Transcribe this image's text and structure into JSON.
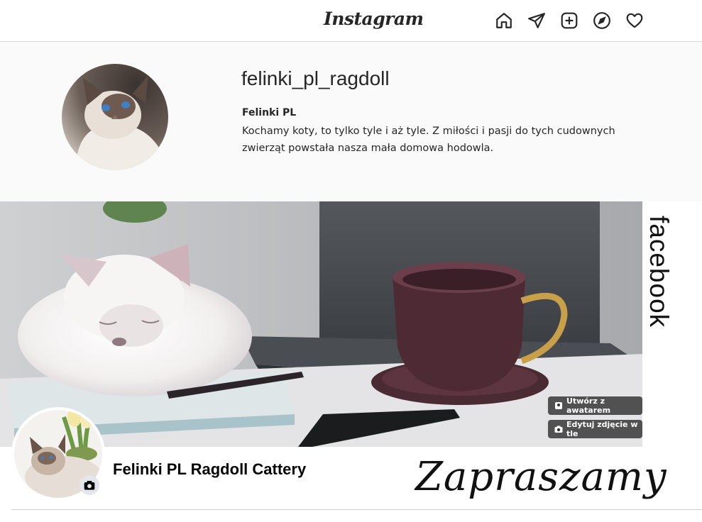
{
  "instagram": {
    "logo": "Instagram",
    "nav_icons": [
      "home-icon",
      "direct-icon",
      "new-post-icon",
      "explore-icon",
      "activity-icon"
    ],
    "username": "felinki_pl_ragdoll",
    "full_name": "Felinki PL",
    "bio": "Kochamy koty, to tylko tyle i aż tyle. Z miłości i pasji do tych cudownych zwierząt powstała nasza mała domowa hodowla."
  },
  "facebook": {
    "side_label": "facebook",
    "create_with_avatar_label": "Utwórz z awatarem",
    "edit_cover_label": "Edytuj zdjęcie w tle",
    "page_name": "Felinki PL Ragdoll Cattery",
    "camera_icon": "camera-icon"
  },
  "tagline": "Zapraszamy",
  "colors": {
    "ig_background": "#fafafa",
    "fb_button_bg": "#282828",
    "text": "#262626"
  }
}
